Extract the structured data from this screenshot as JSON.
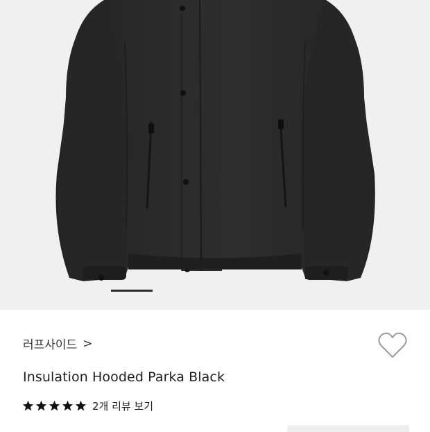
{
  "product": {
    "image_alt": "Insulation Hooded Parka Black",
    "brand": "러프사이드",
    "brand_chevron": ">",
    "title": "Insulation Hooded Parka Black",
    "rating_stars": 5,
    "review_link": "2개 리뷰 보기",
    "image_count": 5,
    "active_image_index": 0
  },
  "icons": {
    "heart": "heart-outline-icon",
    "star": "star-filled-icon"
  },
  "colors": {
    "jacket": "#2a2a2a",
    "background": "#f0f0f0",
    "text": "#1d1d1d"
  }
}
